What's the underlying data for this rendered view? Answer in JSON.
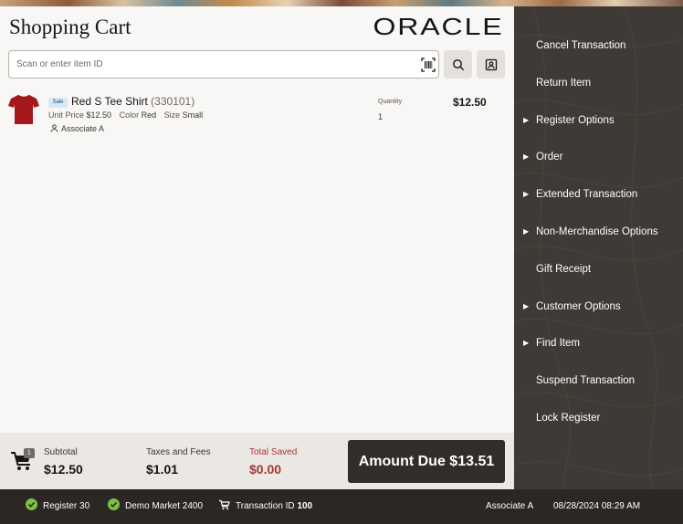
{
  "header": {
    "title": "Shopping Cart",
    "logo_text": "ORACLE",
    "scan_placeholder": "Scan or enter item ID"
  },
  "icons": {
    "barcode": "barcode-scan-icon",
    "search": "search-icon",
    "customer": "customer-card-icon",
    "associate": "person-icon",
    "cart": "cart-icon",
    "status_ok": "check-circle-icon",
    "transaction": "cart-icon"
  },
  "colors": {
    "sidebar_bg": "#3f3a35",
    "status_bar_bg": "#2b2724",
    "amount_button_bg": "#312d2a",
    "saved_text": "#a23737",
    "status_ok": "#7cc142",
    "shirt": "#a5171c"
  },
  "cart": {
    "items": [
      {
        "badge": "Sale",
        "name": "Red S Tee Shirt",
        "item_id": "(330101)",
        "unit_price_label": "Unit Price",
        "unit_price": "$12.50",
        "color_label": "Color",
        "color": "Red",
        "size_label": "Size",
        "size": "Small",
        "associate": "Associate A",
        "quantity_label": "Quantity",
        "quantity": "1",
        "price": "$12.50"
      }
    ]
  },
  "sidebar": {
    "items": [
      {
        "label": "Cancel Transaction",
        "submenu": false
      },
      {
        "label": "Return Item",
        "submenu": false
      },
      {
        "label": "Register Options",
        "submenu": true
      },
      {
        "label": "Order",
        "submenu": true
      },
      {
        "label": "Extended Transaction",
        "submenu": true
      },
      {
        "label": "Non-Merchandise Options",
        "submenu": true
      },
      {
        "label": "Gift Receipt",
        "submenu": false
      },
      {
        "label": "Customer Options",
        "submenu": true
      },
      {
        "label": "Find Item",
        "submenu": true
      },
      {
        "label": "Suspend Transaction",
        "submenu": false
      },
      {
        "label": "Lock Register",
        "submenu": false
      }
    ]
  },
  "totals": {
    "item_count": "1",
    "subtotal_label": "Subtotal",
    "subtotal": "$12.50",
    "taxes_label": "Taxes and Fees",
    "taxes": "$1.01",
    "saved_label": "Total Saved",
    "saved": "$0.00",
    "amount_due_label": "Amount Due $13.51"
  },
  "status_bar": {
    "register": "Register 30",
    "store": "Demo Market 2400",
    "transaction_label": "Transaction ID",
    "transaction_id": "100",
    "associate": "Associate A",
    "datetime": "08/28/2024 08:29 AM"
  }
}
